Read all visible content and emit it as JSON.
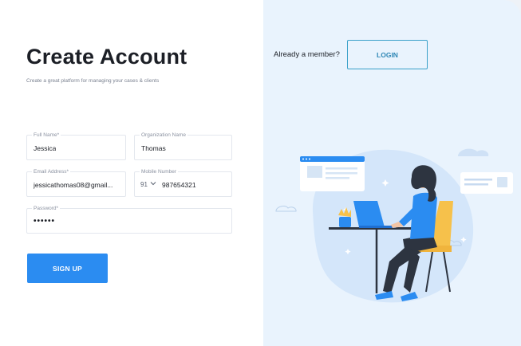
{
  "header": {
    "title": "Create Account",
    "subtitle": "Create a great platform for managing your cases & clients"
  },
  "form": {
    "full_name": {
      "label": "Full Name*",
      "value": "Jessica"
    },
    "organization": {
      "label": "Organization Name",
      "value": "Thomas"
    },
    "email": {
      "label": "Email Address*",
      "value": "jessicathomas08@gmail..."
    },
    "mobile": {
      "label": "Mobile Number",
      "country_code": "91",
      "value": "987654321"
    },
    "password": {
      "label": "Password*",
      "value": "••••••"
    },
    "signup_label": "SIGN UP"
  },
  "auth_prompt": {
    "text": "Already a member?",
    "login_label": "LOGIN"
  },
  "colors": {
    "accent": "#2b8cf1",
    "panel_bg": "#e9f3fd",
    "login_border": "#3aa0c9"
  },
  "illustration": {
    "icon": "person-working-on-laptop-illustration"
  }
}
